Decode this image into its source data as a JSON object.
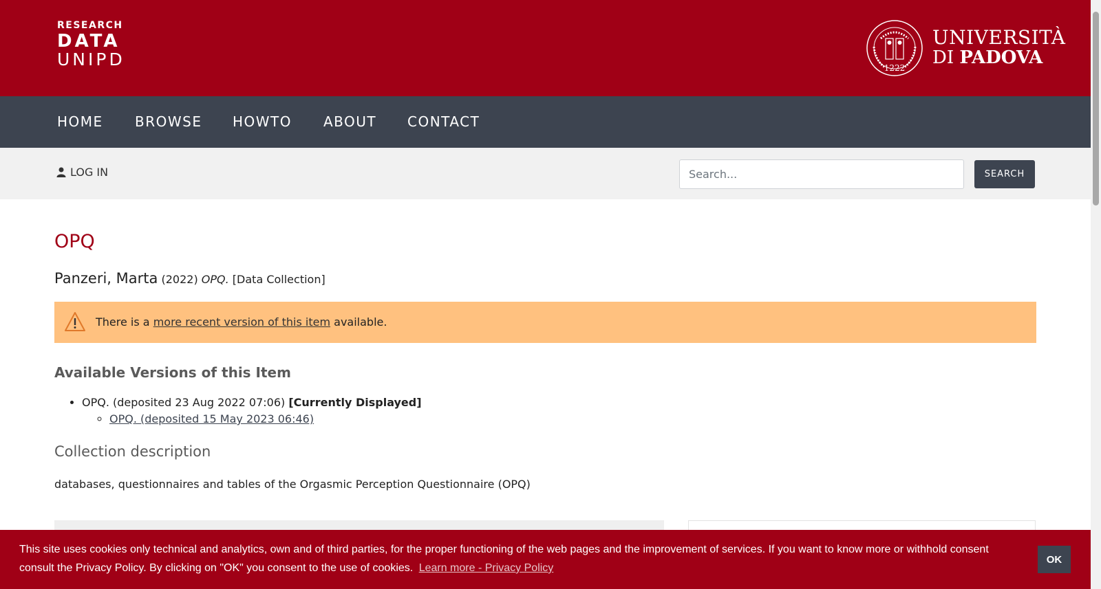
{
  "header": {
    "logo_research": "RESEARCH",
    "logo_data": "DATA",
    "logo_unipd": "UNIPD",
    "university_line1": "UNIVERSITÀ",
    "university_di": "DI",
    "university_padova": "PADOVA",
    "seal_year": "1222"
  },
  "nav": {
    "items": [
      {
        "label": "HOME"
      },
      {
        "label": "BROWSE"
      },
      {
        "label": "HOWTO"
      },
      {
        "label": "ABOUT"
      },
      {
        "label": "CONTACT"
      }
    ]
  },
  "subbar": {
    "login_label": "LOG IN",
    "search_placeholder": "Search...",
    "search_button": "SEARCH"
  },
  "item": {
    "title": "OPQ",
    "author": "Panzeri, Marta",
    "year": "(2022)",
    "citation_title": "OPQ.",
    "type": "[Data Collection]"
  },
  "alert": {
    "prefix": "There is a",
    "link": "more recent version of this item",
    "suffix": "available."
  },
  "versions": {
    "heading": "Available Versions of this Item",
    "current_text": "OPQ. (deposited 23 Aug 2022 07:06)",
    "current_tag": "[Currently Displayed]",
    "newer_link": "OPQ. (deposited 15 May 2023 06:46)"
  },
  "collection": {
    "heading": "Collection description",
    "description": "databases, questionnaires and tables of the Orgasmic Perception Questionnaire (OPQ)"
  },
  "cookie": {
    "text": "This site uses cookies only technical and analytics, own and of third parties, for the proper functioning of the web pages and the improvement of services. If you want to know more or withhold consent consult the Privacy Policy. By clicking on \"OK\" you consent to the use of cookies.",
    "link": "Learn more - Privacy Policy",
    "ok_label": "OK"
  },
  "colors": {
    "brand_red": "#a00016",
    "nav_dark": "#3d4450",
    "alert_orange": "#ffc17f"
  }
}
